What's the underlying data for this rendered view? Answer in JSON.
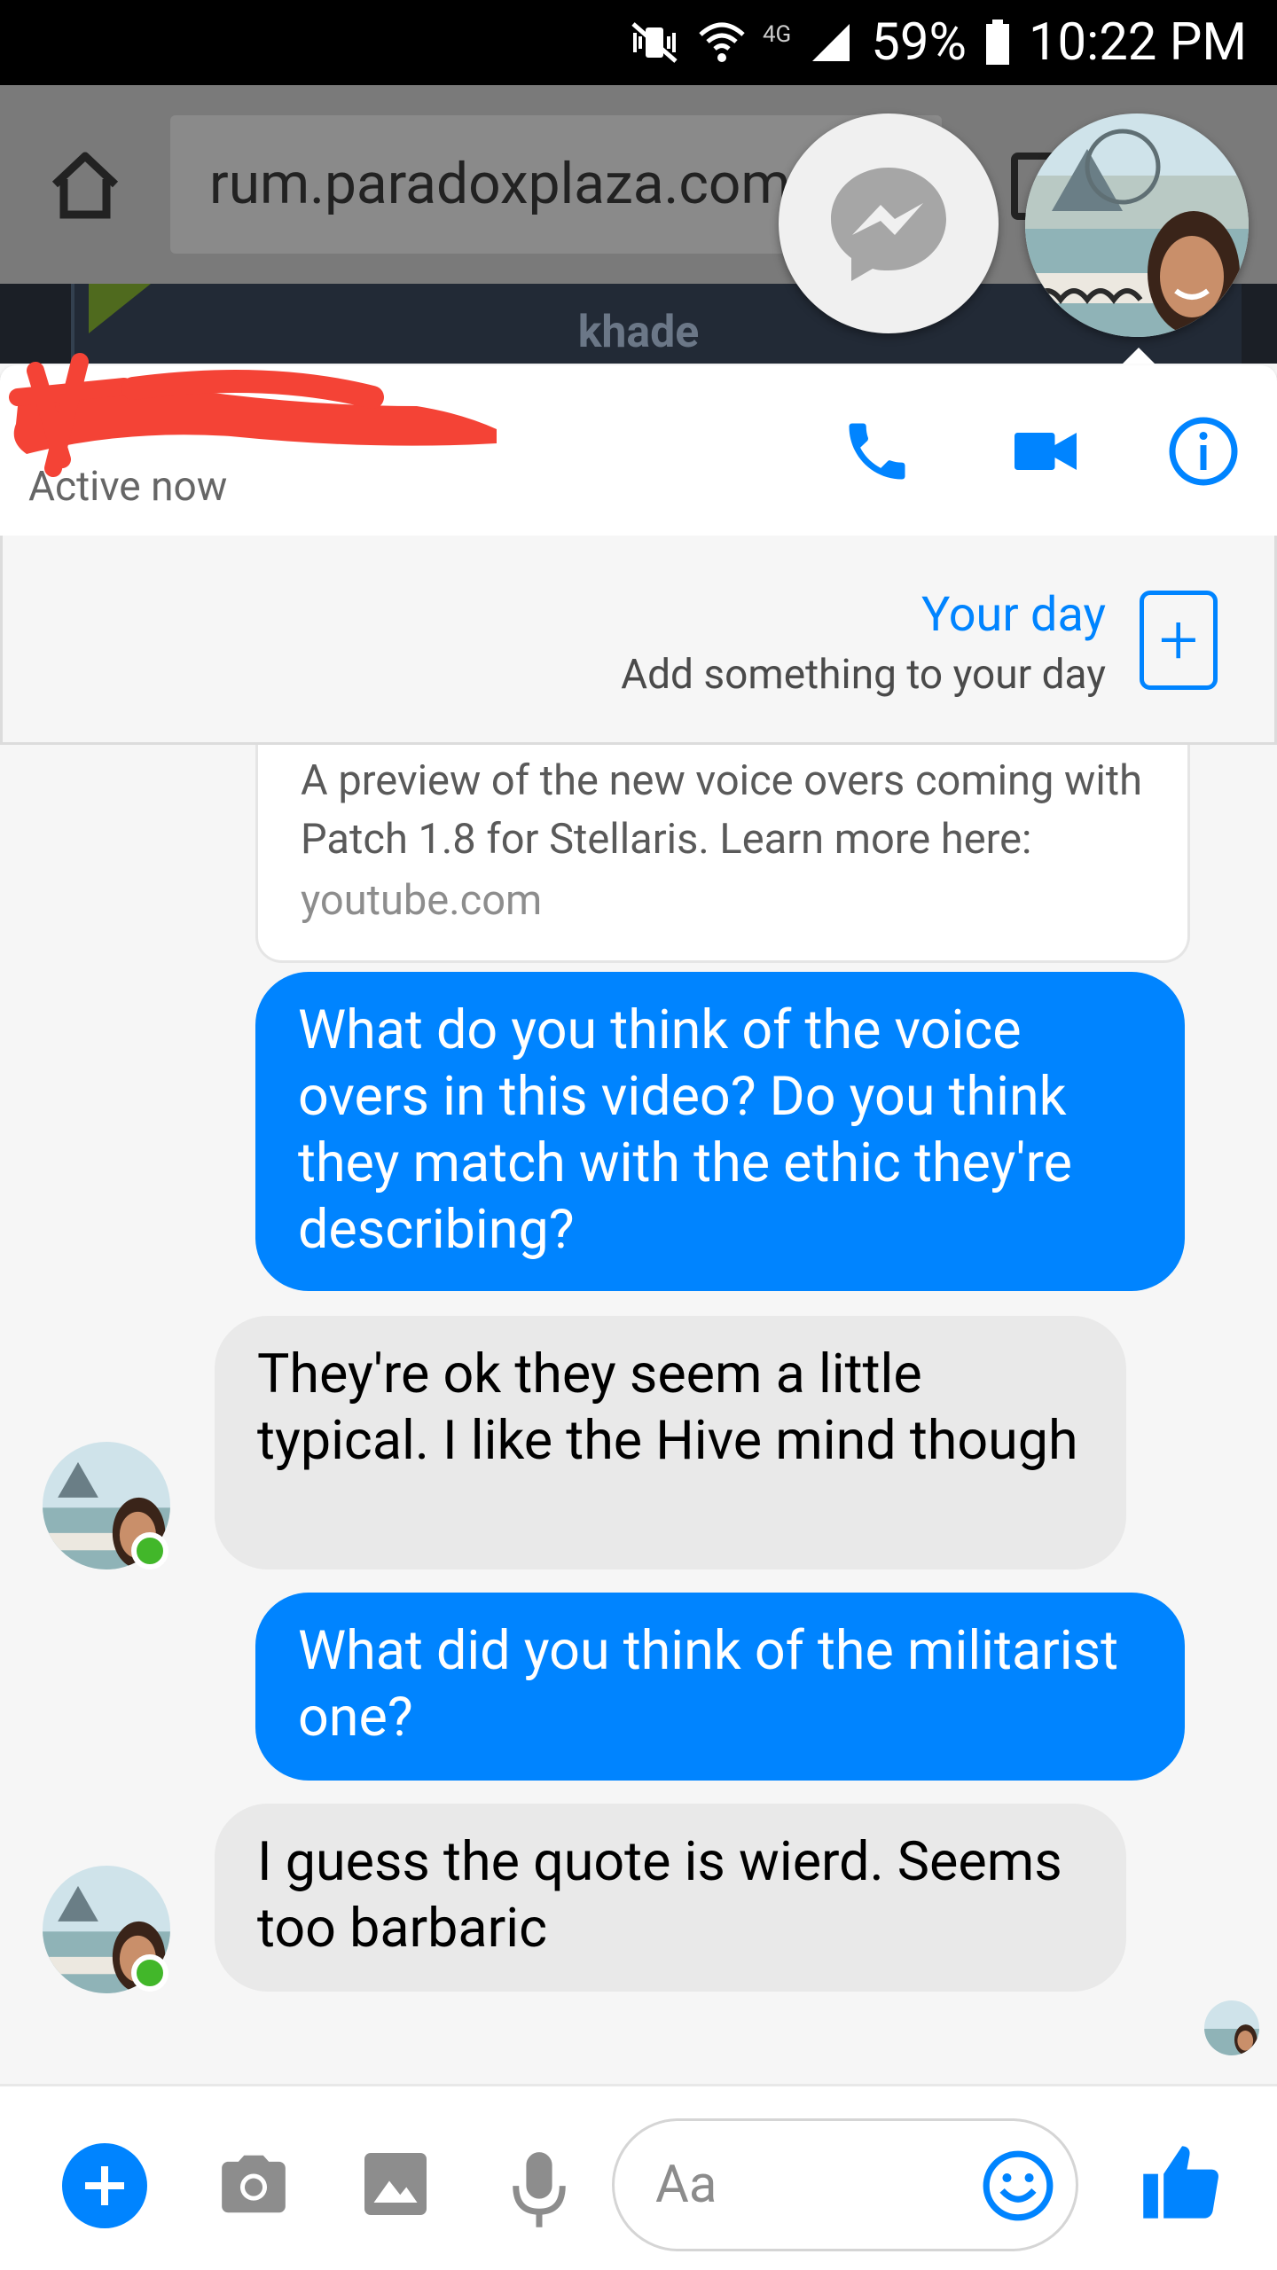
{
  "status_bar": {
    "battery": "59%",
    "time": "10:22 PM",
    "network": "4G"
  },
  "browser": {
    "url": "rum.paradoxplaza.com",
    "forum_username": "khade"
  },
  "chat_header": {
    "status": "Active now",
    "icons": [
      "phone-icon",
      "video-camera-icon",
      "info-icon"
    ]
  },
  "your_day": {
    "title": "Your day",
    "subtitle": "Add something to your day"
  },
  "messages": {
    "link_card": {
      "description": "A preview of the new voice overs coming with Patch 1.8 for Stellaris. Learn more here:",
      "domain": "youtube.com"
    },
    "m1": "What do you think of the voice overs in this video? Do you think they match with the ethic they're describing?",
    "m2": "They're ok they seem a little typical. I like the Hive mind though",
    "m3": "What did you think of the militarist one?",
    "m4": "I guess the quote is wierd. Seems too barbaric"
  },
  "composer": {
    "placeholder": "Aa"
  },
  "colors": {
    "accent": "#0084ff",
    "incoming_bubble": "#e9e9e9",
    "online": "#42b72a",
    "redaction": "#f44336"
  }
}
